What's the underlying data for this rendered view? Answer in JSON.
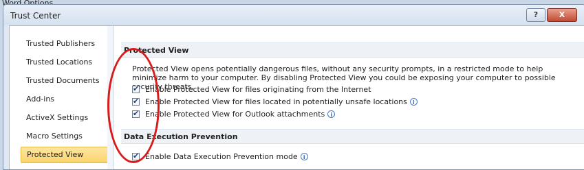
{
  "background_window": {
    "title": "Word Options"
  },
  "dialog": {
    "title": "Trust Center",
    "help_label": "?",
    "close_label": "X"
  },
  "sidebar": {
    "items": [
      {
        "label": "Trusted Publishers"
      },
      {
        "label": "Trusted Locations"
      },
      {
        "label": "Trusted Documents"
      },
      {
        "label": "Add-ins"
      },
      {
        "label": "ActiveX Settings"
      },
      {
        "label": "Macro Settings"
      },
      {
        "label": "Protected View",
        "selected": true
      }
    ]
  },
  "protected_view": {
    "header": "Protected View",
    "description": "Protected View opens potentially dangerous files, without any security prompts, in a restricted mode to help minimize harm to your computer. By disabling Protected View you could be exposing your computer to possible security threats.",
    "options": [
      {
        "label": "Enable Protected View for files originating from the Internet",
        "checked": true,
        "info": false
      },
      {
        "label": "Enable Protected View for files located in potentially unsafe locations",
        "checked": true,
        "info": true
      },
      {
        "label": "Enable Protected View for Outlook attachments",
        "checked": true,
        "info": true
      }
    ]
  },
  "dep": {
    "header": "Data Execution Prevention",
    "options": [
      {
        "label": "Enable Data Execution Prevention mode",
        "checked": true,
        "info": true
      }
    ]
  },
  "icons": {
    "check": "✔",
    "info": "i"
  },
  "colors": {
    "selection": "#fbd56a",
    "annotation": "#d81c1c"
  }
}
